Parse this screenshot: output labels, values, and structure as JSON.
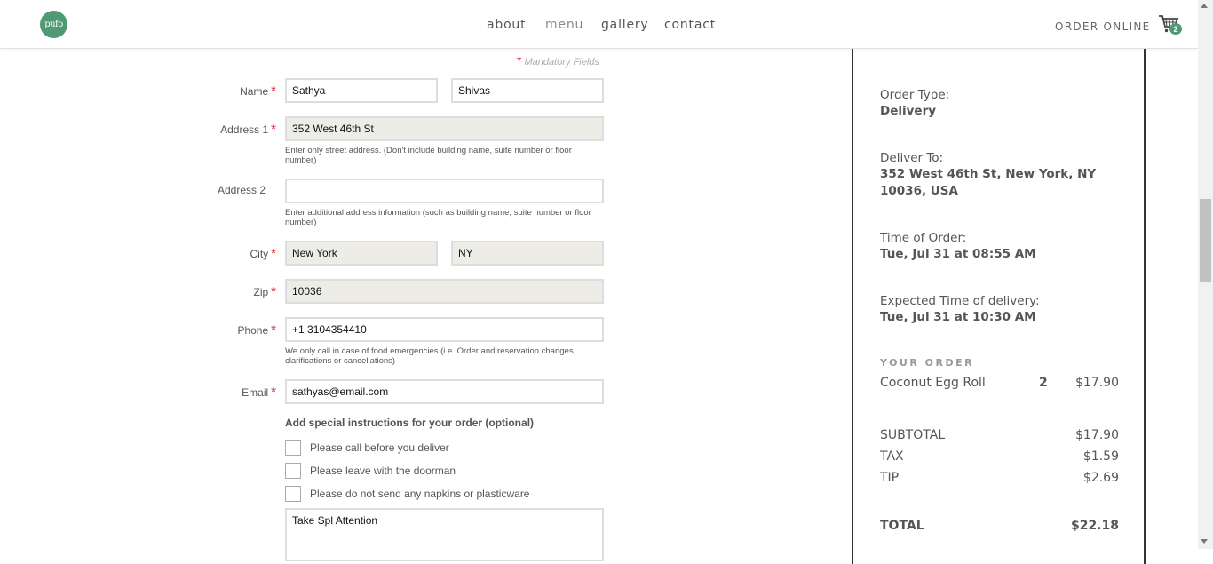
{
  "header": {
    "logo_text": "pufo",
    "nav": [
      "about",
      "menu",
      "gallery",
      "contact"
    ],
    "order_online": "ORDER ONLINE",
    "cart_count": "2",
    "accent_color": "#4f9a72"
  },
  "form": {
    "mandatory_note": "Mandatory Fields",
    "name_label": "Name",
    "first_name": "Sathya",
    "last_name": "Shivas",
    "address1_label": "Address 1",
    "address1": "352 West 46th St",
    "address1_help": "Enter only street address. (Don't include building name, suite number or floor number)",
    "address2_label": "Address 2",
    "address2": "",
    "address2_help": "Enter additional address information (such as building name, suite number or floor number)",
    "city_label": "City",
    "city": "New York",
    "state": "NY",
    "zip_label": "Zip",
    "zip": "10036",
    "phone_label": "Phone",
    "phone": "+1 3104354410",
    "phone_help": "We only call in case of food emergencies (i.e. Order and reservation changes, clarifications or cancellations)",
    "email_label": "Email",
    "email": "sathyas@email.com",
    "instructions_title": "Add special instructions for your order (optional)",
    "options": [
      "Please call before you deliver",
      "Please leave with the doorman",
      "Please do not send any napkins or plasticware"
    ],
    "special_text": "Take Spl Attention"
  },
  "summary": {
    "order_type_label": "Order Type:",
    "order_type": "Delivery",
    "deliver_to_label": "Deliver To:",
    "deliver_to": "352 West 46th St, New York, NY 10036, USA",
    "time_of_order_label": "Time of Order:",
    "time_of_order": "Tue, Jul 31 at 08:55 AM",
    "expected_label": "Expected Time of delivery:",
    "expected": "Tue, Jul 31 at 10:30 AM",
    "your_order": "YOUR ORDER",
    "item_name": "Coconut Egg Roll",
    "item_qty": "2",
    "item_price": "$17.90",
    "subtotal_label": "SUBTOTAL",
    "subtotal": "$17.90",
    "tax_label": "TAX",
    "tax": "$1.59",
    "tip_label": "TIP",
    "tip": "$2.69",
    "total_label": "TOTAL",
    "total": "$22.18"
  }
}
